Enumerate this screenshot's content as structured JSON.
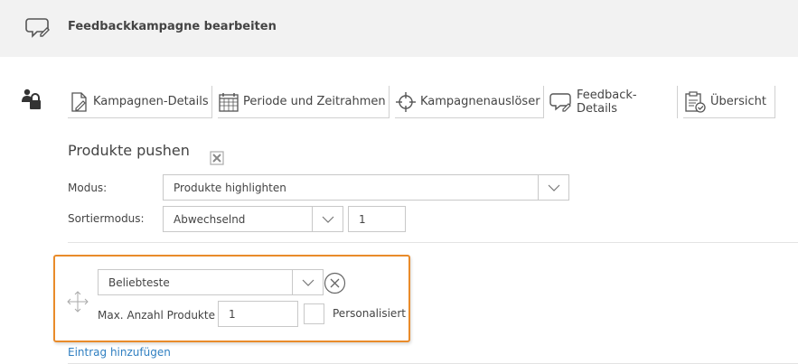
{
  "header": {
    "title": "Feedbackkampagne bearbeiten",
    "icon": "chat-edit-icon"
  },
  "tabs": [
    {
      "label": "Kampagnen-Details",
      "icon": "document-edit-icon"
    },
    {
      "label": "Periode und Zeitrahmen",
      "icon": "calendar-icon"
    },
    {
      "label": "Kampagnenauslöser",
      "icon": "crosshair-icon"
    },
    {
      "label": "Feedback-Details",
      "icon": "chat-bubble-icon"
    },
    {
      "label": "Übersicht",
      "icon": "clipboard-check-icon"
    }
  ],
  "active_tab": "Feedback-Details",
  "section": {
    "title": "Produkte pushen"
  },
  "form": {
    "modus_label": "Modus:",
    "modus_value": "Produkte highlighten",
    "sortiermodus_label": "Sortiermodus:",
    "sortiermodus_value": "Abwechselnd",
    "sortier_count": "1"
  },
  "entry": {
    "select_value": "Beliebteste",
    "max_label": "Max. Anzahl Produkte",
    "max_value": "1",
    "personalisiert_label": "Personalisiert",
    "personalisiert_checked": false
  },
  "add_entry_label": "Eintrag hinzufügen",
  "colors": {
    "header_bg": "#f2f2f2",
    "highlight_border": "#e98b2a",
    "link": "#2f7fc1"
  }
}
